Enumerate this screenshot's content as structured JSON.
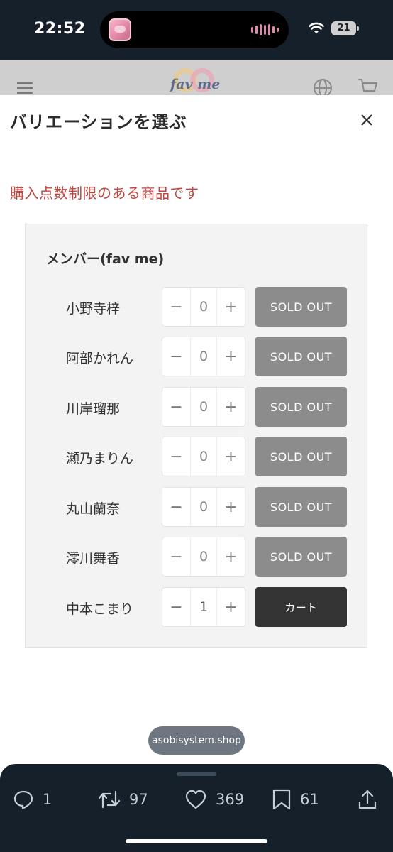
{
  "status_bar": {
    "time": "22:52",
    "battery": "21",
    "icons": [
      "now-playing-artwork",
      "waveform-icon",
      "wifi-icon",
      "battery-icon"
    ]
  },
  "shop_header": {
    "logo_text": "fav me",
    "icons": [
      "hamburger-icon",
      "globe-icon",
      "cart-icon"
    ]
  },
  "modal": {
    "title": "バリエーションを選ぶ",
    "close_icon": "close-icon",
    "limit_notice": "購入点数制限のある商品です",
    "group_label": "メンバー(fav me)",
    "items": [
      {
        "name": "小野寺梓",
        "qty": "0",
        "button": "SOLD OUT",
        "status": "soldout"
      },
      {
        "name": "阿部かれん",
        "qty": "0",
        "button": "SOLD OUT",
        "status": "soldout"
      },
      {
        "name": "川岸瑠那",
        "qty": "0",
        "button": "SOLD OUT",
        "status": "soldout"
      },
      {
        "name": "瀬乃まりん",
        "qty": "0",
        "button": "SOLD OUT",
        "status": "soldout"
      },
      {
        "name": "丸山蘭奈",
        "qty": "0",
        "button": "SOLD OUT",
        "status": "soldout"
      },
      {
        "name": "澪川舞香",
        "qty": "0",
        "button": "SOLD OUT",
        "status": "soldout"
      },
      {
        "name": "中本こまり",
        "qty": "1",
        "button": "カート",
        "status": "available"
      }
    ],
    "minus": "−",
    "plus": "+"
  },
  "url_pill": "asobisystem.shop",
  "tweet_actions": {
    "reply_count": "1",
    "retweet_count": "97",
    "like_count": "369",
    "bookmark_count": "61"
  },
  "colors": {
    "status_bar_bg": "#15202b",
    "notice_red": "#c0463f",
    "soldout_gray": "#8c8c8c",
    "cart_dark": "#333333"
  }
}
